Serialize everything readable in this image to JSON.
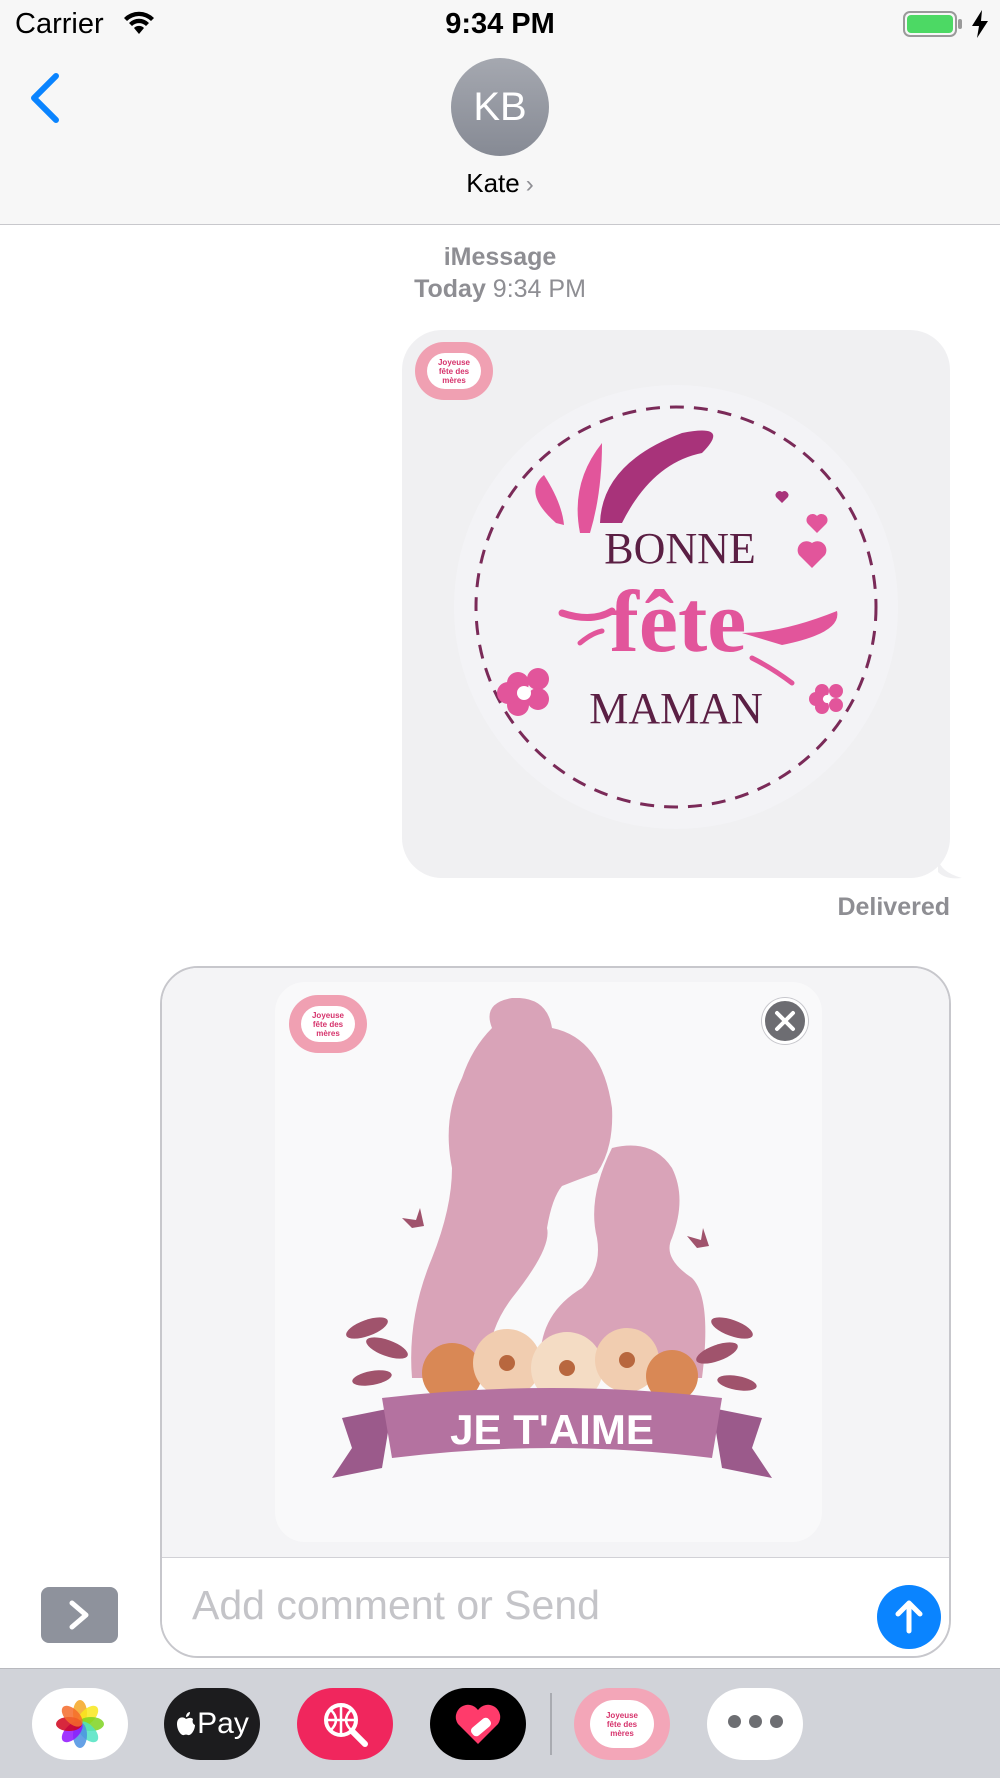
{
  "status_bar": {
    "carrier": "Carrier",
    "time": "9:34 PM"
  },
  "header": {
    "avatar_initials": "KB",
    "contact_name": "Kate",
    "contact_chevron": "›"
  },
  "transcript": {
    "service": "iMessage",
    "timestamp_day": "Today",
    "timestamp_time": "9:34 PM",
    "delivered": "Delivered",
    "sticker_1": {
      "line1": "BONNE",
      "line2": "fête",
      "line3": "MAMAN"
    }
  },
  "compose": {
    "sticker_2": {
      "banner": "JE T'AIME"
    },
    "badge_text": [
      "Joyeuse",
      "fête des",
      "mères"
    ],
    "placeholder": "Add comment or Send",
    "value": ""
  },
  "app_drawer": {
    "items": [
      "photos-app",
      "apple-pay-app",
      "web-image-search-app",
      "digital-touch-app",
      "joyeuse-fete-des-meres-app",
      "more-apps"
    ],
    "pay_label": "Pay"
  },
  "colors": {
    "accent": "#0a84ff",
    "bubble": "#f0f0f2",
    "sticker_pink": "#e2559b",
    "sticker_plum": "#5b1f44"
  }
}
